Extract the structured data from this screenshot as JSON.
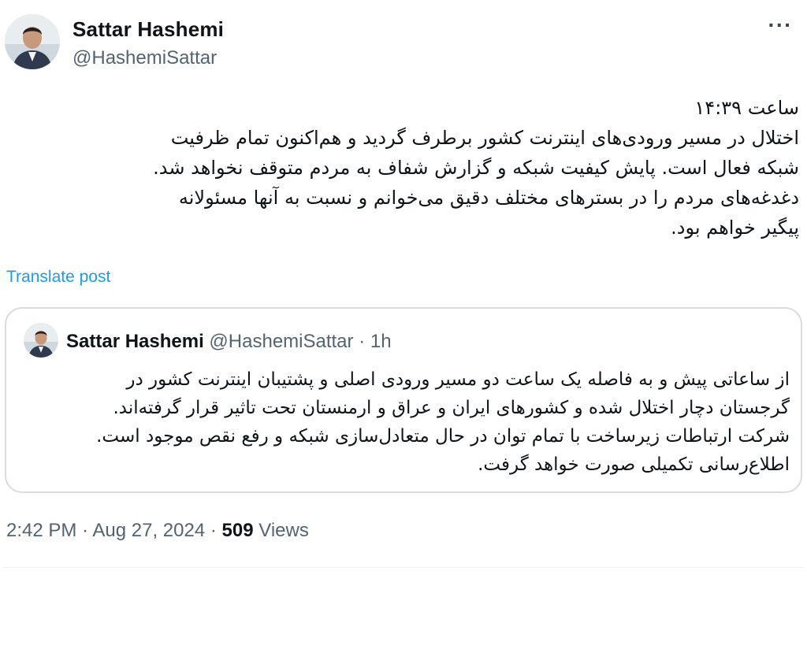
{
  "author": {
    "display_name": "Sattar Hashemi",
    "handle": "@HashemiSattar"
  },
  "post": {
    "lines": [
      "ساعت ۱۴:۳۹",
      "اختلال در مسیر ورودی‌های اینترنت کشور برطرف گردید و هم‌اکنون تمام ظرفیت",
      "شبکه فعال است. پایش کیفیت شبکه و گزارش شفاف به مردم متوقف نخواهد شد.",
      "دغدغه‌های مردم را در بسترهای مختلف دقیق می‌خوانم و نسبت به آنها مسئولانه",
      "پیگیر خواهم بود."
    ],
    "translate_label": "Translate post"
  },
  "quote": {
    "display_name": "Sattar Hashemi",
    "handle": "@HashemiSattar",
    "separator": "·",
    "time": "1h",
    "lines": [
      "از ساعاتی پیش و به فاصله یک ساعت دو مسیر ورودی اصلی و پشتیبان اینترنت کشور در",
      "گرجستان دچار اختلال شده و کشورهای ایران و عراق و ارمنستان تحت تاثیر قرار گرفته‌اند.",
      "شرکت ارتباطات زیرساخت با تمام توان در حال متعادل‌سازی شبکه و رفع نقص موجود است.",
      "اطلاع‌رسانی تکمیلی صورت خواهد گرفت."
    ]
  },
  "footer": {
    "time": "2:42 PM",
    "separator": "·",
    "date": "Aug 27, 2024",
    "views_count": "509",
    "views_label": "Views"
  },
  "icons": {
    "more": "more-horizontal-icon"
  },
  "colors": {
    "text": "#0f1419",
    "secondary": "#536471",
    "link": "#1d9bf0",
    "border": "#d9dde0"
  }
}
